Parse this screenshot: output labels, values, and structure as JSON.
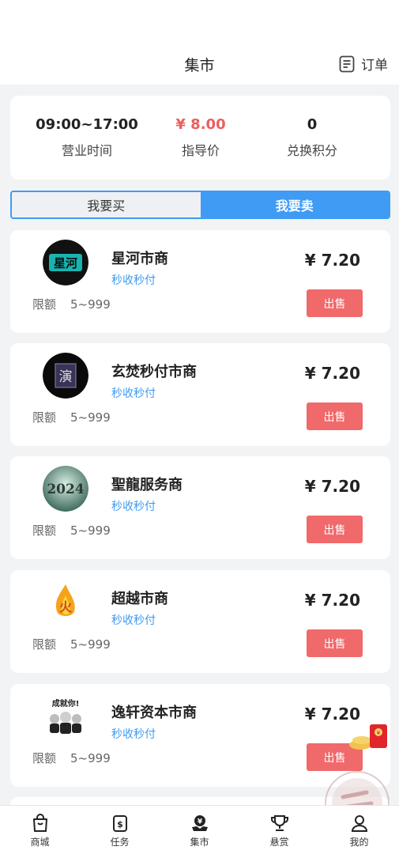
{
  "header": {
    "title": "集市",
    "orders_label": "订单"
  },
  "stats": {
    "hours_value": "09:00~17:00",
    "hours_label": "营业时间",
    "price_value": "¥ 8.00",
    "price_label": "指导价",
    "points_value": "0",
    "points_label": "兑换积分"
  },
  "tabs": {
    "buy": "我要买",
    "sell": "我要卖"
  },
  "merchants": [
    {
      "name": "星河市商",
      "tag": "秒收秒付",
      "price": "¥ 7.20",
      "limit_label": "限额",
      "limit_value": "5~999",
      "button": "出售"
    },
    {
      "name": "玄焚秒付市商",
      "tag": "秒收秒付",
      "price": "¥ 7.20",
      "limit_label": "限额",
      "limit_value": "5~999",
      "button": "出售"
    },
    {
      "name": "聖龍服务商",
      "tag": "秒收秒付",
      "price": "¥ 7.20",
      "limit_label": "限额",
      "limit_value": "5~999",
      "button": "出售"
    },
    {
      "name": "超越市商",
      "tag": "秒收秒付",
      "price": "¥ 7.20",
      "limit_label": "限额",
      "limit_value": "5~999",
      "button": "出售"
    },
    {
      "name": "逸轩资本市商",
      "tag": "秒收秒付",
      "price": "¥ 7.20",
      "limit_label": "限额",
      "limit_value": "5~999",
      "button": "出售"
    }
  ],
  "avatars": {
    "a0": "星河",
    "a1": "演",
    "a2": "2024",
    "a3": "火",
    "a4": "成就你!"
  },
  "nav": [
    {
      "label": "商城",
      "icon": "shopping-bag-icon"
    },
    {
      "label": "任务",
      "icon": "task-icon"
    },
    {
      "label": "集市",
      "icon": "market-icon"
    },
    {
      "label": "悬赏",
      "icon": "trophy-icon"
    },
    {
      "label": "我的",
      "icon": "user-icon"
    }
  ],
  "colors": {
    "accent": "#3f9bf4",
    "price_red": "#e8605f",
    "sell_button": "#f0696b"
  }
}
